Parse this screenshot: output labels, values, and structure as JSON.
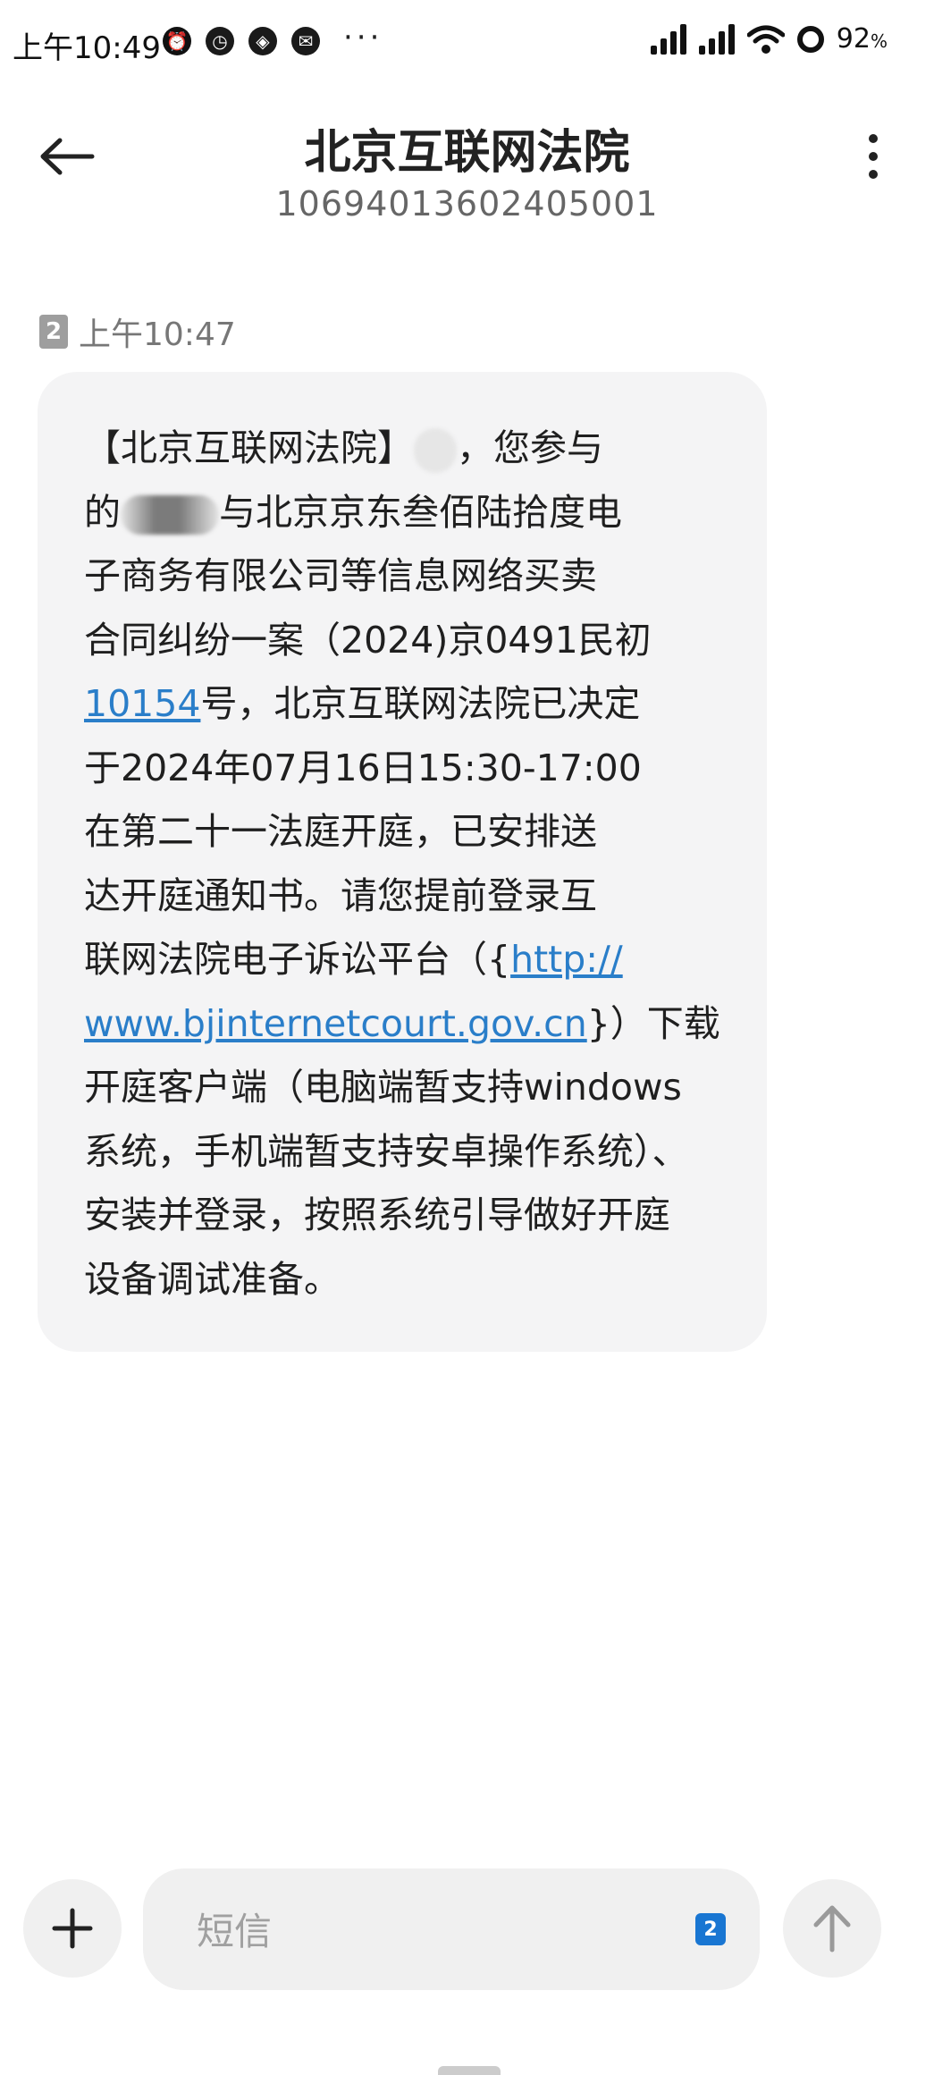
{
  "status_bar": {
    "time": "上午10:49",
    "more": "···",
    "battery": "92",
    "battery_unit": "%"
  },
  "header": {
    "title": "北京互联网法院",
    "number": "10694013602405001"
  },
  "message": {
    "sim": "2",
    "time": "上午10:47",
    "seg1": "【北京互联网法院】",
    "seg2": "，您参与\n的",
    "seg3": "与北京京东叁佰陆拾度电\n子商务有限公司等信息网络买卖\n合同纠纷一案（2024)京0491民初\n",
    "case_link": "10154",
    "seg4": "号，北京互联网法院已决定\n于2024年07月16日15:30-17:00\n在第二十一法庭开庭，已安排送\n达开庭通知书。请您提前登录互\n联网法院电子诉讼平台（{",
    "url_link": "http://\nwww.bjinternetcourt.gov.cn",
    "seg5": "}）下载\n开庭客户端（电脑端暂支持windows\n系统，手机端暂支持安卓操作系统）、\n安装并登录，按照系统引导做好开庭\n设备调试准备。"
  },
  "composer": {
    "placeholder": "短信",
    "sim": "2"
  },
  "colors": {
    "link": "#2a7ec9",
    "bubble": "#f4f4f5",
    "sim_badge": "#1976d2"
  },
  "icons": {
    "back": "arrow-left-icon",
    "more": "more-vertical-icon",
    "add": "plus-icon",
    "send": "arrow-up-icon"
  }
}
